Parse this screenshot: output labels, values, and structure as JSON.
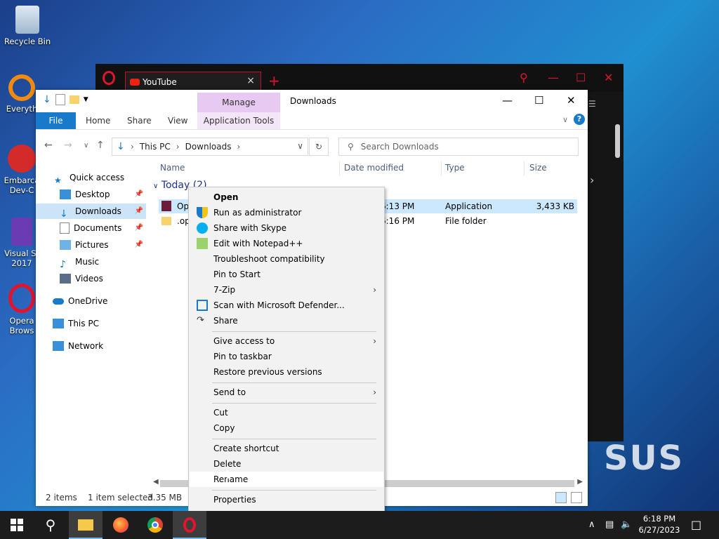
{
  "desktop": {
    "icons": [
      {
        "label": "Recycle Bin"
      },
      {
        "label": "Everyth"
      },
      {
        "label": "Embarca Dev-C"
      },
      {
        "label": "Visual St 2017"
      },
      {
        "label": "Opera Brows"
      }
    ],
    "wallpaper_text": "SUS"
  },
  "opera": {
    "tab_title": "YouTube",
    "new_tab_label": "+",
    "close_label": "×"
  },
  "explorer": {
    "manage_label": "Manage",
    "title": "Downloads",
    "ribbon_tabs": {
      "file": "File",
      "home": "Home",
      "share": "Share",
      "view": "View",
      "app_tools": "Application Tools"
    },
    "address": {
      "crumbs": [
        "This PC",
        "Downloads"
      ]
    },
    "search_placeholder": "Search Downloads",
    "nav": [
      {
        "label": "Quick access",
        "pinned": false
      },
      {
        "label": "Desktop",
        "pinned": true
      },
      {
        "label": "Downloads",
        "pinned": true,
        "selected": true
      },
      {
        "label": "Documents",
        "pinned": true
      },
      {
        "label": "Pictures",
        "pinned": true
      },
      {
        "label": "Music",
        "pinned": false
      },
      {
        "label": "Videos",
        "pinned": false
      },
      {
        "label": "OneDrive",
        "pinned": false
      },
      {
        "label": "This PC",
        "pinned": false
      },
      {
        "label": "Network",
        "pinned": false
      }
    ],
    "columns": {
      "name": "Name",
      "date": "Date modified",
      "type": "Type",
      "size": "Size"
    },
    "group": "Today (2)",
    "rows": [
      {
        "name": "Ope",
        "date": "6:13 PM",
        "type": "Application",
        "size": "3,433 KB",
        "selected": true
      },
      {
        "name": ".op",
        "date": "6:16 PM",
        "type": "File folder",
        "size": "",
        "selected": false
      }
    ],
    "status": {
      "items": "2 items",
      "selected": "1 item selected",
      "size": "3.35 MB"
    }
  },
  "context_menu": {
    "items": [
      {
        "label": "Open",
        "bold": true
      },
      {
        "label": "Run as administrator",
        "icon": "shield-icon"
      },
      {
        "label": "Share with Skype",
        "icon": "skype-icon"
      },
      {
        "label": "Edit with Notepad++",
        "icon": "notepadpp-icon"
      },
      {
        "label": "Troubleshoot compatibility"
      },
      {
        "label": "Pin to Start"
      },
      {
        "label": "7-Zip",
        "submenu": true
      },
      {
        "label": "Scan with Microsoft Defender...",
        "icon": "defender-icon"
      },
      {
        "label": "Share",
        "icon": "share-icon"
      },
      {
        "label": "Give access to",
        "submenu": true
      },
      {
        "label": "Pin to taskbar"
      },
      {
        "label": "Restore previous versions"
      },
      {
        "label": "Send to",
        "submenu": true
      },
      {
        "label": "Cut"
      },
      {
        "label": "Copy"
      },
      {
        "label": "Create shortcut"
      },
      {
        "label": "Delete"
      },
      {
        "label": "Rename",
        "hover": true
      },
      {
        "label": "Properties"
      }
    ]
  },
  "taskbar": {
    "time": "6:18 PM",
    "date": "6/27/2023",
    "pinned": [
      "start-icon",
      "search-icon",
      "file-explorer-icon",
      "firefox-icon",
      "chrome-icon",
      "opera-icon"
    ]
  },
  "colors": {
    "accent": "#1979ca",
    "selection": "#cce8ff",
    "opera_red": "#e2142d",
    "manage_bg": "#e8c9f2"
  }
}
